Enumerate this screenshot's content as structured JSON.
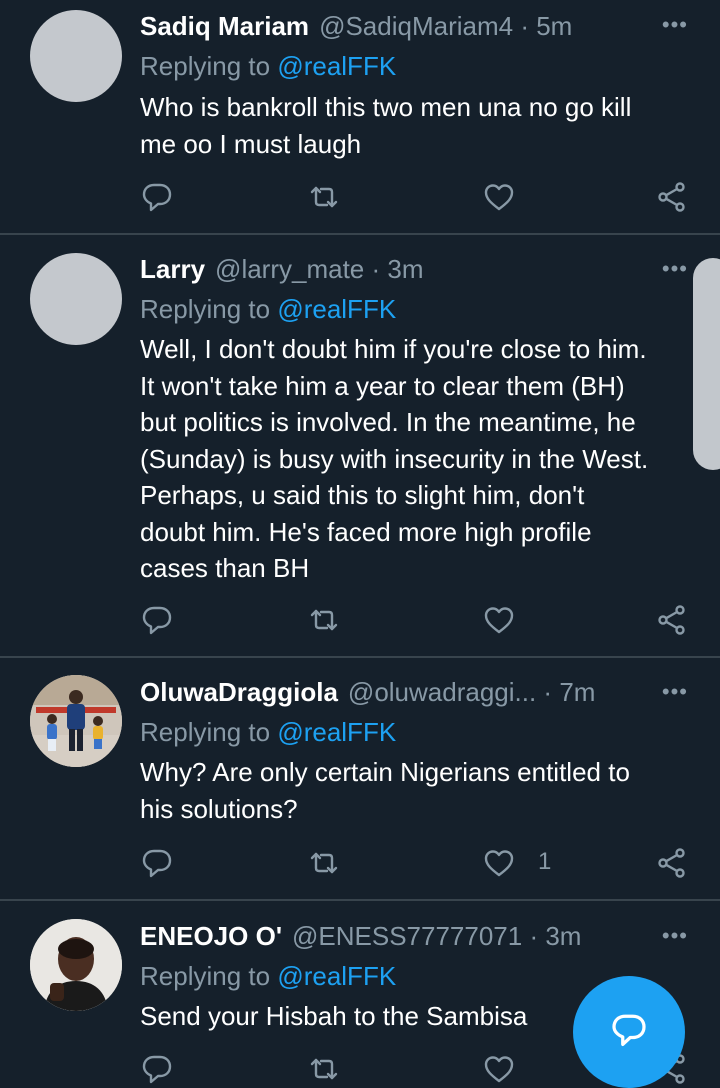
{
  "tweets": [
    {
      "name": "Sadiq Mariam",
      "handle": "@SadiqMariam4",
      "time": "5m",
      "reply_prefix": "Replying to",
      "reply_handle": "@realFFK",
      "lines": [
        "Who is bankroll this two men una no go kill",
        "me oo I must laugh"
      ],
      "likes": ""
    },
    {
      "name": "Larry",
      "handle": "@larry_mate",
      "time": "3m",
      "reply_prefix": "Replying to",
      "reply_handle": "@realFFK",
      "lines": [
        "Well, I don't doubt him if you're close to him.",
        "It won't take him a year to clear them (BH)",
        "but politics is involved. In the meantime, he",
        "(Sunday) is busy with insecurity in the West.",
        "Perhaps, u said this to slight him, don't",
        "doubt him. He's faced more high profile",
        "cases than BH"
      ],
      "likes": ""
    },
    {
      "name": "OluwaDraggiola",
      "handle": "@oluwadraggi...",
      "time": "7m",
      "reply_prefix": "Replying to",
      "reply_handle": "@realFFK",
      "lines": [
        "Why? Are only certain Nigerians entitled to",
        "his solutions?"
      ],
      "likes": "1"
    },
    {
      "name": "ENEOJO O'",
      "handle": "@ENESS77777071",
      "time": "3m",
      "reply_prefix": "Replying to",
      "reply_handle": "@realFFK",
      "lines": [
        "Send your Hisbah to the Sambisa"
      ],
      "likes": ""
    }
  ],
  "icons": {
    "more": "more-dots-icon",
    "reply": "reply-bubble-icon",
    "retweet": "retweet-icon",
    "like": "heart-icon",
    "share": "share-icon",
    "compose": "compose-reply-icon"
  },
  "colors": {
    "background": "#15202b",
    "text": "#ffffff",
    "secondary": "#8899a6",
    "accent": "#1da1f2",
    "divider": "#38444d"
  }
}
